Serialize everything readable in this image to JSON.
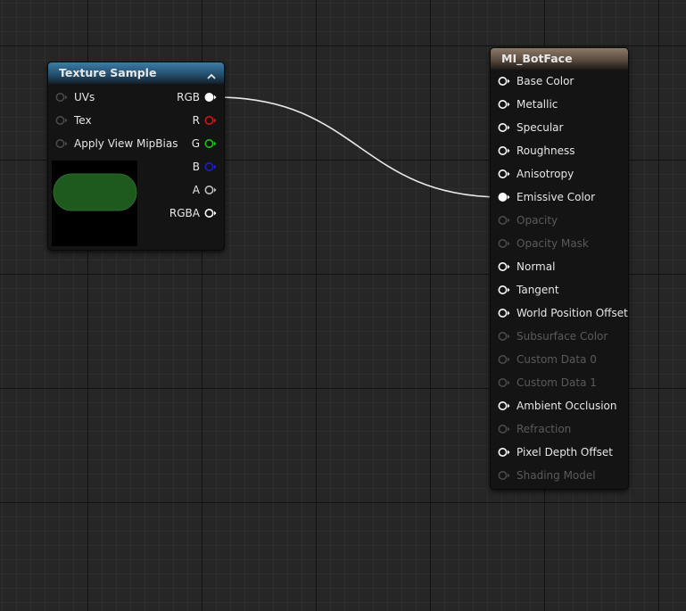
{
  "texture_node": {
    "title": "Texture Sample",
    "inputs": [
      {
        "label": "UVs"
      },
      {
        "label": "Tex"
      },
      {
        "label": "Apply View MipBias"
      }
    ],
    "outputs": [
      {
        "label": "RGB",
        "color": "#ffffff",
        "connected": true
      },
      {
        "label": "R",
        "color": "#d01616",
        "connected": false
      },
      {
        "label": "G",
        "color": "#18c21a",
        "connected": false
      },
      {
        "label": "B",
        "color": "#1c1cd8",
        "connected": false
      },
      {
        "label": "A",
        "color": "#bfbfbf",
        "connected": false
      },
      {
        "label": "RGBA",
        "color": "#ffffff",
        "connected": false
      }
    ],
    "preview_color": "#1e5a1e"
  },
  "material_node": {
    "title": "MI_BotFace",
    "inputs": [
      {
        "label": "Base Color",
        "enabled": true,
        "connected": false
      },
      {
        "label": "Metallic",
        "enabled": true,
        "connected": false
      },
      {
        "label": "Specular",
        "enabled": true,
        "connected": false
      },
      {
        "label": "Roughness",
        "enabled": true,
        "connected": false
      },
      {
        "label": "Anisotropy",
        "enabled": true,
        "connected": false
      },
      {
        "label": "Emissive Color",
        "enabled": true,
        "connected": true
      },
      {
        "label": "Opacity",
        "enabled": false,
        "connected": false
      },
      {
        "label": "Opacity Mask",
        "enabled": false,
        "connected": false
      },
      {
        "label": "Normal",
        "enabled": true,
        "connected": false
      },
      {
        "label": "Tangent",
        "enabled": true,
        "connected": false
      },
      {
        "label": "World Position Offset",
        "enabled": true,
        "connected": false
      },
      {
        "label": "Subsurface Color",
        "enabled": false,
        "connected": false
      },
      {
        "label": "Custom Data 0",
        "enabled": false,
        "connected": false
      },
      {
        "label": "Custom Data 1",
        "enabled": false,
        "connected": false
      },
      {
        "label": "Ambient Occlusion",
        "enabled": true,
        "connected": false
      },
      {
        "label": "Refraction",
        "enabled": false,
        "connected": false
      },
      {
        "label": "Pixel Depth Offset",
        "enabled": true,
        "connected": false
      },
      {
        "label": "Shading Model",
        "enabled": false,
        "connected": false
      }
    ]
  },
  "connection": {
    "from": "RGB",
    "to": "Emissive Color",
    "color": "#e8e8e8"
  }
}
